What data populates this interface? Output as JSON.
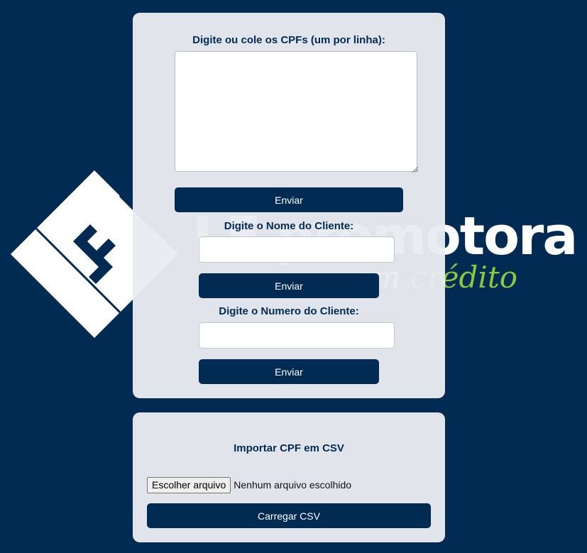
{
  "colors": {
    "background": "#022b54",
    "card": "#e8ebf1",
    "button": "#022b54",
    "brand_green": "#8dc63f"
  },
  "brand": {
    "name": "LF promotora",
    "tagline_em": "em ",
    "tagline_credito": "crédito"
  },
  "cpf_form": {
    "label": "Digite ou cole os CPFs (um por linha):",
    "value": "",
    "submit_label": "Enviar"
  },
  "name_form": {
    "label": "Digite o Nome do Cliente:",
    "value": "",
    "submit_label": "Enviar"
  },
  "number_form": {
    "label": "Digite o Numero do Cliente:",
    "value": "",
    "submit_label": "Enviar"
  },
  "csv_import": {
    "title": "Importar CPF em CSV",
    "file_button_label": "Escolher arquivo",
    "file_status": "Nenhum arquivo escolhido",
    "upload_label": "Carregar CSV"
  }
}
